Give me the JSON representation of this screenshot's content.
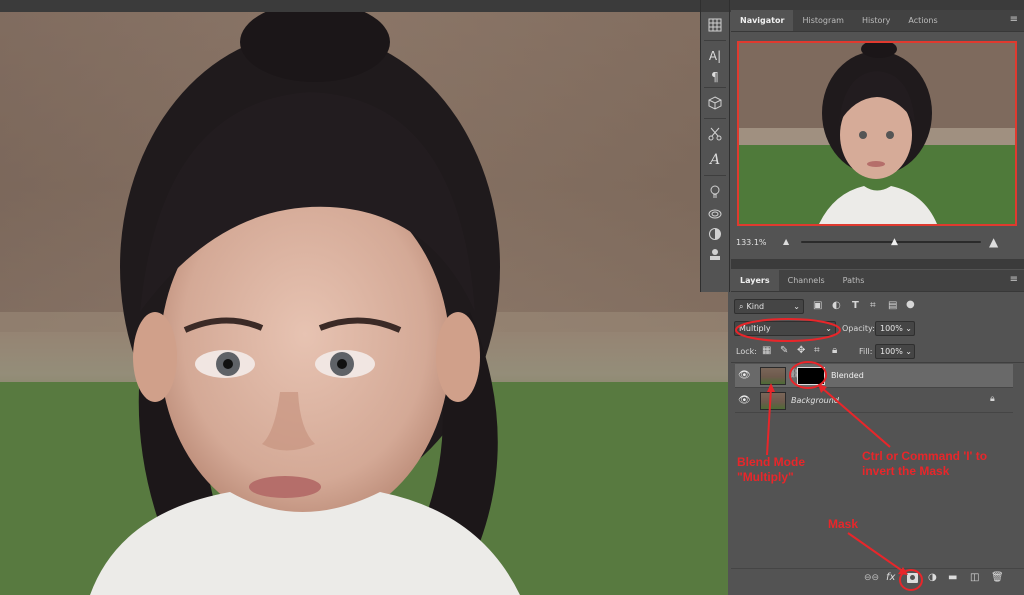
{
  "dock": {
    "tools": [
      "grid-icon",
      "character-icon",
      "paragraph-icon",
      "3d-cube-icon",
      "scissors-icon",
      "glyphs-icon",
      "lightbulb-icon",
      "libraries-icon",
      "adjustments-icon",
      "layers-stack-icon"
    ],
    "text": {
      "char": "A|",
      "para": "¶",
      "glyph": "A"
    }
  },
  "navigator": {
    "tabs": [
      "Navigator",
      "Histogram",
      "History",
      "Actions"
    ],
    "active_tab": "Navigator",
    "zoom": "133.1%"
  },
  "layers_panel": {
    "tabs": [
      "Layers",
      "Channels",
      "Paths"
    ],
    "active_tab": "Layers",
    "filter_label": "Kind",
    "blend_mode": "Multiply",
    "opacity_label": "Opacity:",
    "opacity_value": "100%",
    "lock_label": "Lock:",
    "fill_label": "Fill:",
    "fill_value": "100%",
    "layers": [
      {
        "name": "Blended",
        "visible": true,
        "selected": true,
        "has_mask": true
      },
      {
        "name": "Background",
        "visible": true,
        "selected": false,
        "locked": true
      }
    ],
    "bottom_icons": [
      "link-icon",
      "fx-icon",
      "add-mask-icon",
      "adjustment-layer-icon",
      "new-group-icon",
      "new-layer-icon",
      "trash-icon"
    ],
    "fx_text": "fx"
  },
  "annotations": {
    "blend_mode": [
      "Blend Mode",
      "\"Multiply\""
    ],
    "invert": [
      "Ctrl or Command 'I' to",
      "invert the Mask"
    ],
    "mask": "Mask"
  },
  "colors": {
    "annotation": "#e8262a",
    "panel": "#535353",
    "tabbar": "#424242"
  }
}
